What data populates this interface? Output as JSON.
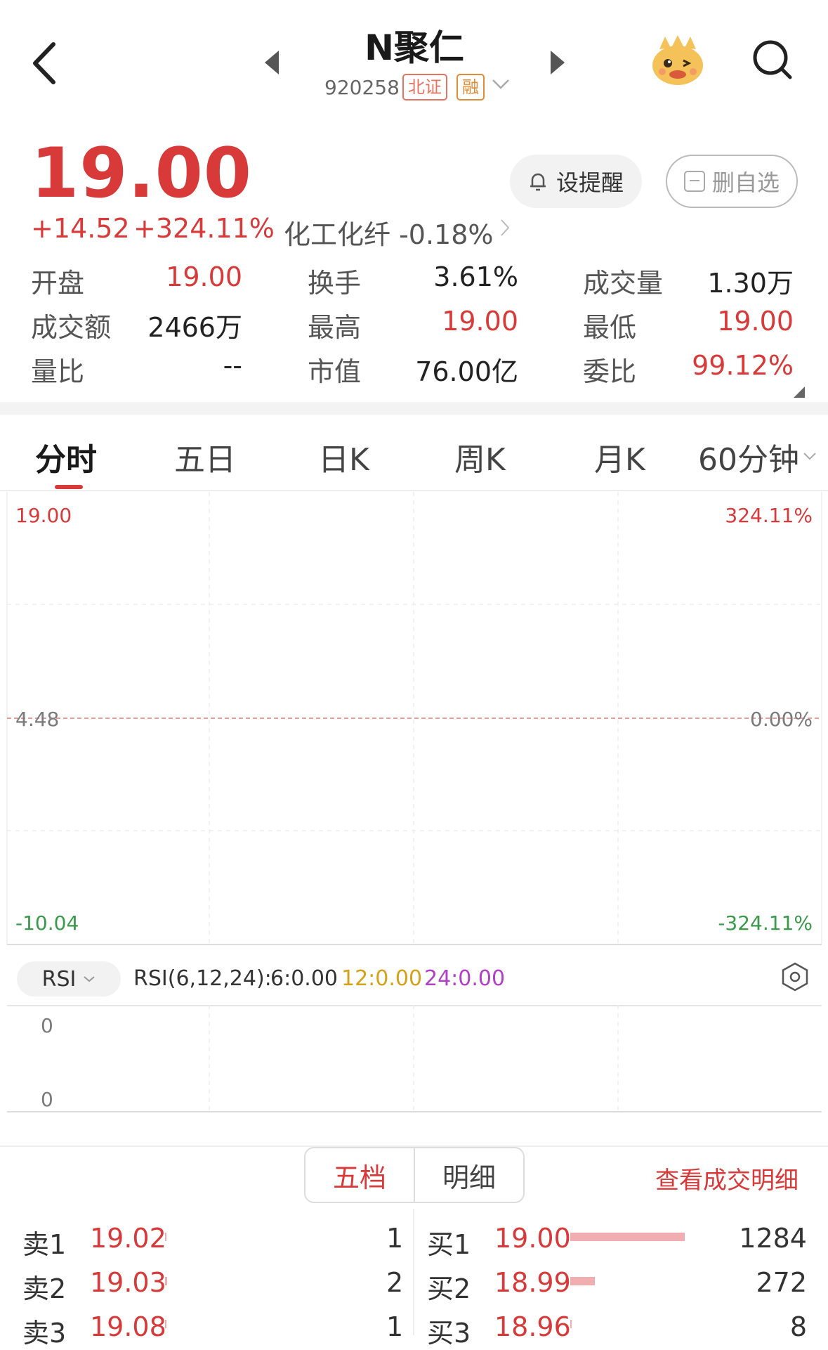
{
  "header": {
    "stock_name": "N聚仁",
    "stock_code": "920258",
    "tags": [
      "北证",
      "融"
    ]
  },
  "quote": {
    "price": "19.00",
    "change": "+14.52",
    "change_pct": "+324.11%",
    "sector": "化工化纤 -0.18%",
    "alert_label": "设提醒",
    "watch_label": "删自选"
  },
  "stats": [
    {
      "label": "开盘",
      "value": "19.00",
      "color": "red"
    },
    {
      "label": "换手",
      "value": "3.61%",
      "color": "black"
    },
    {
      "label": "成交量",
      "value": "1.30万",
      "color": "black"
    },
    {
      "label": "成交额",
      "value": "2466万",
      "color": "black"
    },
    {
      "label": "最高",
      "value": "19.00",
      "color": "red"
    },
    {
      "label": "最低",
      "value": "19.00",
      "color": "red"
    },
    {
      "label": "量比",
      "value": "--",
      "color": "black"
    },
    {
      "label": "市值",
      "value": "76.00亿",
      "color": "black"
    },
    {
      "label": "委比",
      "value": "99.12%",
      "color": "red"
    }
  ],
  "tabs": [
    "分时",
    "五日",
    "日K",
    "周K",
    "月K",
    "60分钟"
  ],
  "chart": {
    "price_top": "19.00",
    "price_mid": "4.48",
    "price_bottom": "-10.04",
    "pct_top": "324.11%",
    "pct_mid": "0.00%",
    "pct_bottom": "-324.11%"
  },
  "rsi": {
    "selector": "RSI",
    "params": "RSI(6,12,24):",
    "rsi6": "6:0.00",
    "rsi12": "12:0.00",
    "rsi24": "24:0.00",
    "axis_top": "0",
    "axis_bottom": "0",
    "colors": {
      "rsi12": "#d6a019",
      "rsi24": "#b23fc8"
    }
  },
  "order_book": {
    "seg_a": "五档",
    "seg_b": "明细",
    "view_detail": "查看成交明细",
    "sells": [
      {
        "label": "卖1",
        "price": "19.02",
        "vol": "1"
      },
      {
        "label": "卖2",
        "price": "19.03",
        "vol": "2"
      },
      {
        "label": "卖3",
        "price": "19.08",
        "vol": "1"
      }
    ],
    "buys": [
      {
        "label": "买1",
        "price": "19.00",
        "vol": "1284",
        "fill": 0.9
      },
      {
        "label": "买2",
        "price": "18.99",
        "vol": "272",
        "fill": 0.19
      },
      {
        "label": "买3",
        "price": "18.96",
        "vol": "8",
        "fill": 0.01
      }
    ]
  },
  "theme": {
    "accent_red": "#d83a3a",
    "down_green": "#3a9a4a"
  }
}
